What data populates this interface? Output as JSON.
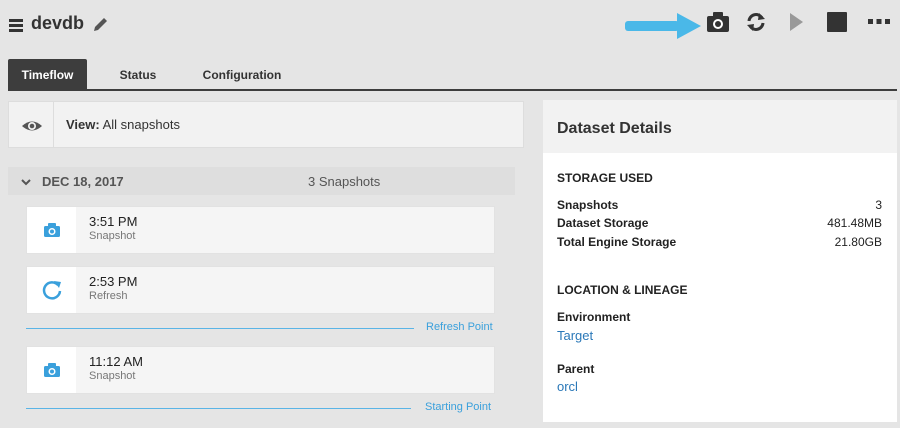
{
  "header": {
    "title": "devdb"
  },
  "toolbar": {
    "icons": [
      "camera-icon",
      "refresh-icon",
      "play-icon",
      "stop-icon",
      "more-icon"
    ],
    "arrow_color": "#4ab8e8"
  },
  "tabs": [
    {
      "label": "Timeflow",
      "active": true
    },
    {
      "label": "Status",
      "active": false
    },
    {
      "label": "Configuration",
      "active": false
    }
  ],
  "view": {
    "prefix": "View:",
    "value": "All snapshots"
  },
  "timeflow": {
    "date": "DEC 18, 2017",
    "count": "3 Snapshots",
    "items": [
      {
        "time": "3:51 PM",
        "type": "Snapshot",
        "icon": "camera-icon"
      },
      {
        "time": "2:53 PM",
        "type": "Refresh",
        "icon": "refresh-icon"
      },
      {
        "time": "11:12 AM",
        "type": "Snapshot",
        "icon": "camera-icon"
      }
    ],
    "points": [
      "Refresh Point",
      "Starting Point"
    ]
  },
  "details": {
    "title": "Dataset Details",
    "storage_title": "STORAGE USED",
    "storage": [
      {
        "label": "Snapshots",
        "value": "3"
      },
      {
        "label": "Dataset Storage",
        "value": "481.48MB"
      },
      {
        "label": "Total Engine Storage",
        "value": "21.80GB"
      }
    ],
    "location_title": "LOCATION & LINEAGE",
    "environment_label": "Environment",
    "environment_value": "Target",
    "parent_label": "Parent",
    "parent_value": "orcl"
  },
  "colors": {
    "accent": "#3aa0dc",
    "tab_active": "#3d3d3d",
    "link": "#2a78b8"
  }
}
